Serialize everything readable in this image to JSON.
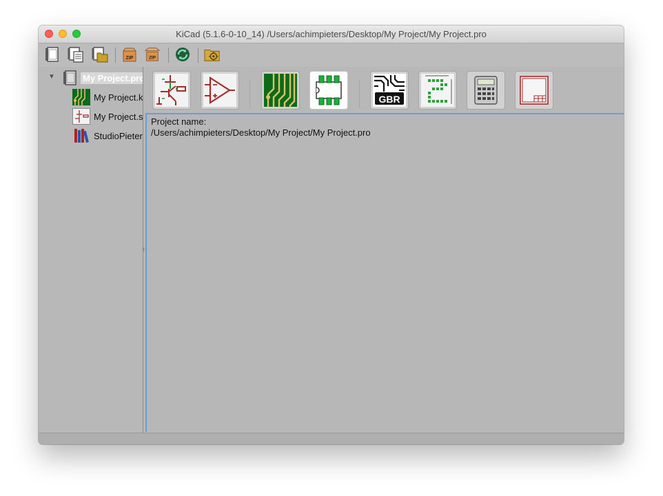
{
  "window": {
    "title": "KiCad (5.1.6-0-10_14) /Users/achimpieters/Desktop/My Project/My Project.pro"
  },
  "toolbar": {
    "items": [
      {
        "name": "new-project-icon"
      },
      {
        "name": "new-from-template-icon"
      },
      {
        "name": "open-project-icon"
      },
      {
        "name": "archive-zip-icon",
        "label": "ZIP"
      },
      {
        "name": "unarchive-zip-icon",
        "label": "ZIP"
      },
      {
        "name": "refresh-icon"
      },
      {
        "name": "project-folder-settings-icon"
      }
    ]
  },
  "project_tree": {
    "root": {
      "label": "My Project.pro"
    },
    "files": [
      {
        "label": "My Project.kicad_pcb",
        "icon": "pcb-file-icon"
      },
      {
        "label": "My Project.sch",
        "icon": "schematic-file-icon"
      },
      {
        "label": "StudioPieters.lib",
        "icon": "library-books-icon"
      }
    ]
  },
  "launchers": [
    {
      "name": "schematic-editor",
      "icon": "schematic-editor-icon"
    },
    {
      "name": "symbol-editor",
      "icon": "opamp-symbol-icon"
    },
    {
      "name": "pcb-editor",
      "icon": "pcb-layout-icon"
    },
    {
      "name": "footprint-editor",
      "icon": "footprint-icon",
      "active": true
    },
    {
      "name": "gerber-viewer",
      "icon": "gerber-icon",
      "label": "GBR"
    },
    {
      "name": "image-converter",
      "icon": "bitmap-to-component-icon"
    },
    {
      "name": "pcb-calculator",
      "icon": "calculator-icon"
    },
    {
      "name": "page-layout-editor",
      "icon": "page-layout-icon"
    }
  ],
  "messages": {
    "project_name_label": "Project name:",
    "project_path": "/Users/achimpieters/Desktop/My Project/My Project.pro"
  },
  "colors": {
    "panel_border_accent": "#6f9ccf",
    "active_launcher_bg": "#ffffff",
    "pcb_green": "#0c6a1a",
    "schematic_red": "#a52a2a"
  }
}
